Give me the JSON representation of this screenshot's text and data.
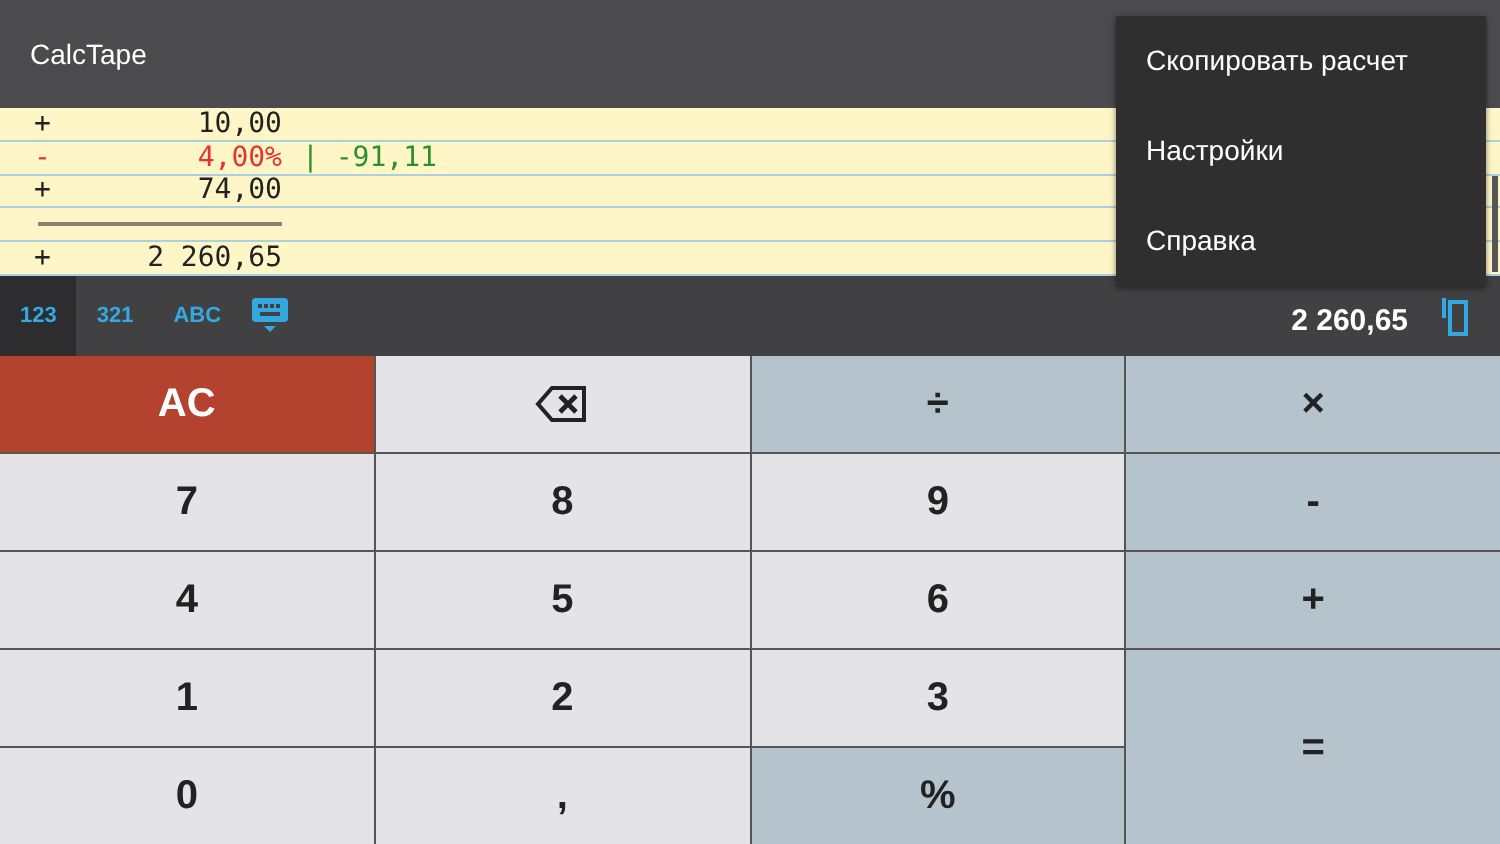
{
  "app_bar": {
    "title": "CalcTape"
  },
  "tape": [
    {
      "kind": "entry",
      "op": "+",
      "value": "10,00"
    },
    {
      "kind": "percent",
      "op": "-",
      "value": "4,00%",
      "result": "| -91,11"
    },
    {
      "kind": "entry",
      "op": "+",
      "value": "74,00"
    },
    {
      "kind": "line"
    },
    {
      "kind": "entry",
      "op": "+",
      "value": "2 260,65"
    }
  ],
  "keyboard_tabs": [
    {
      "label": "123",
      "selected": true
    },
    {
      "label": "321",
      "selected": false
    },
    {
      "label": "ABC",
      "selected": false
    }
  ],
  "total": "2 260,65",
  "keys": [
    {
      "label": "AC",
      "kind": "clear"
    },
    {
      "kind": "backspace"
    },
    {
      "label": "÷",
      "kind": "op"
    },
    {
      "label": "×",
      "kind": "op"
    },
    {
      "label": "7",
      "kind": "digit"
    },
    {
      "label": "8",
      "kind": "digit"
    },
    {
      "label": "9",
      "kind": "digit"
    },
    {
      "label": "-",
      "kind": "op"
    },
    {
      "label": "4",
      "kind": "digit"
    },
    {
      "label": "5",
      "kind": "digit"
    },
    {
      "label": "6",
      "kind": "digit"
    },
    {
      "label": "+",
      "kind": "op"
    },
    {
      "label": "1",
      "kind": "digit"
    },
    {
      "label": "2",
      "kind": "digit"
    },
    {
      "label": "3",
      "kind": "digit"
    },
    {
      "label": "=",
      "kind": "equals"
    },
    {
      "label": "0",
      "kind": "digit"
    },
    {
      "label": ",",
      "kind": "digit"
    },
    {
      "label": "%",
      "kind": "op"
    }
  ],
  "menu": [
    {
      "label": "Скопировать расчет"
    },
    {
      "label": "Настройки"
    },
    {
      "label": "Справка"
    }
  ]
}
